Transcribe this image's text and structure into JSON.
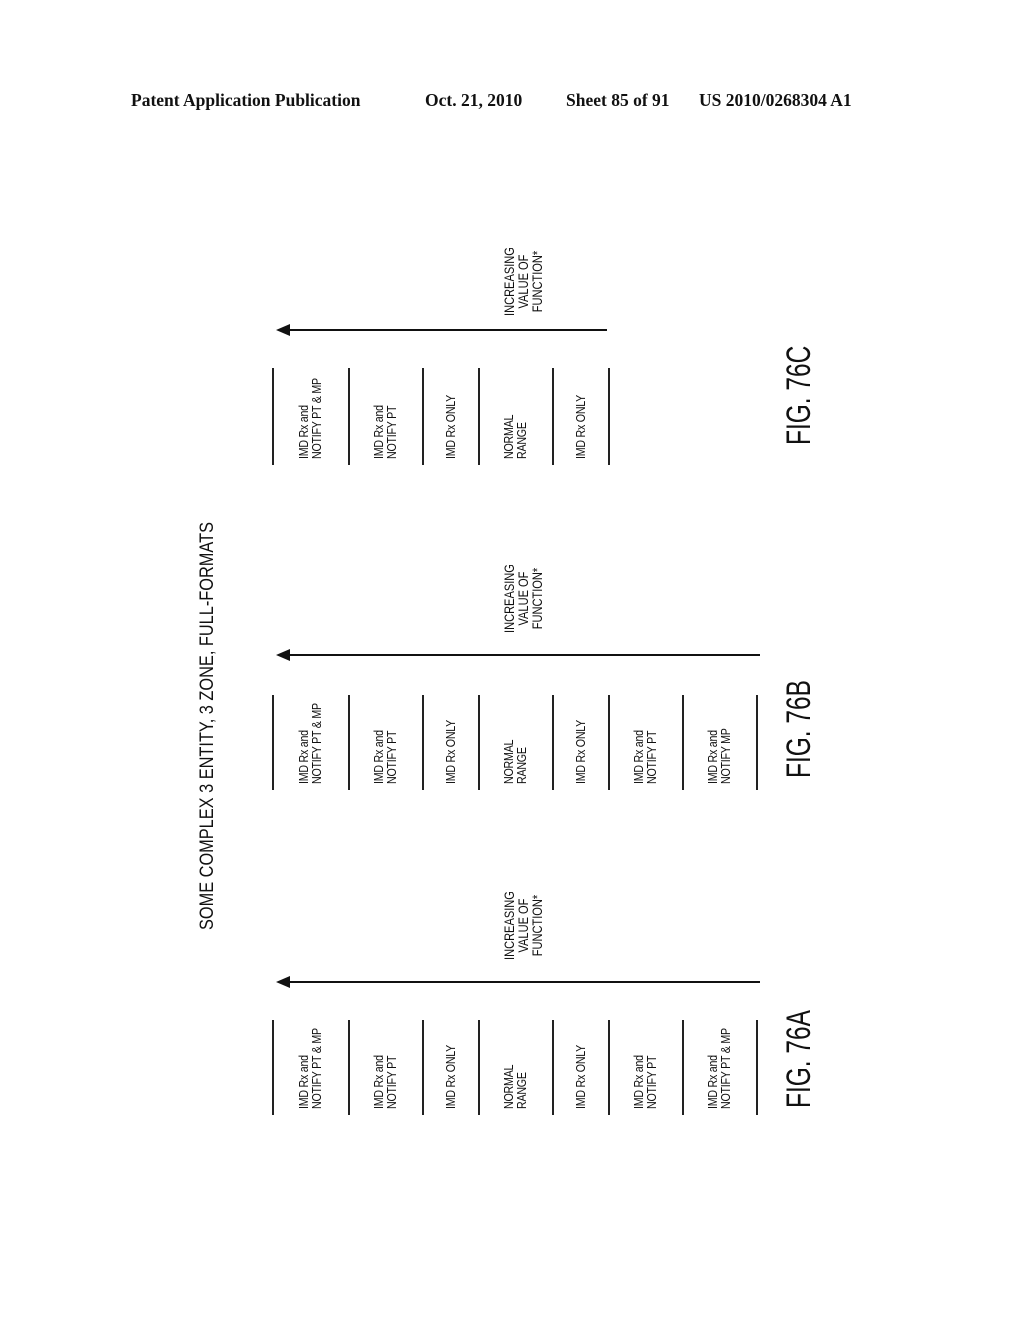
{
  "header": {
    "publication": "Patent Application Publication",
    "date": "Oct. 21, 2010",
    "sheet": "Sheet 85 of 91",
    "number": "US 2010/0268304 A1"
  },
  "title": "SOME COMPLEX 3 ENTITY, 3 ZONE, FULL-FORMATS",
  "arrow_label": [
    "INCREASING",
    "VALUE OF",
    "FUNCTION*"
  ],
  "figures": [
    {
      "label": "FIG. 76A",
      "zones": [
        [
          "IMD Rx and",
          "NOTIFY PT & MP"
        ],
        [
          "IMD Rx and",
          "NOTIFY PT"
        ],
        [
          "IMD Rx ONLY"
        ],
        [
          "NORMAL",
          "RANGE"
        ],
        [
          "IMD Rx ONLY"
        ],
        [
          "IMD Rx and",
          "NOTIFY PT"
        ],
        [
          "IMD Rx and",
          "NOTIFY PT & MP"
        ]
      ]
    },
    {
      "label": "FIG. 76B",
      "zones": [
        [
          "IMD Rx and",
          "NOTIFY PT & MP"
        ],
        [
          "IMD Rx and",
          "NOTIFY PT"
        ],
        [
          "IMD Rx ONLY"
        ],
        [
          "NORMAL",
          "RANGE"
        ],
        [
          "IMD Rx ONLY"
        ],
        [
          "IMD Rx and",
          "NOTIFY PT"
        ],
        [
          "IMD Rx and",
          "NOTIFY MP"
        ]
      ]
    },
    {
      "label": "FIG. 76C",
      "zones": [
        [
          "IMD Rx and",
          "NOTIFY PT & MP"
        ],
        [
          "IMD Rx and",
          "NOTIFY PT"
        ],
        [
          "IMD Rx ONLY"
        ],
        [
          "NORMAL",
          "RANGE"
        ],
        [
          "IMD Rx ONLY"
        ]
      ]
    }
  ]
}
